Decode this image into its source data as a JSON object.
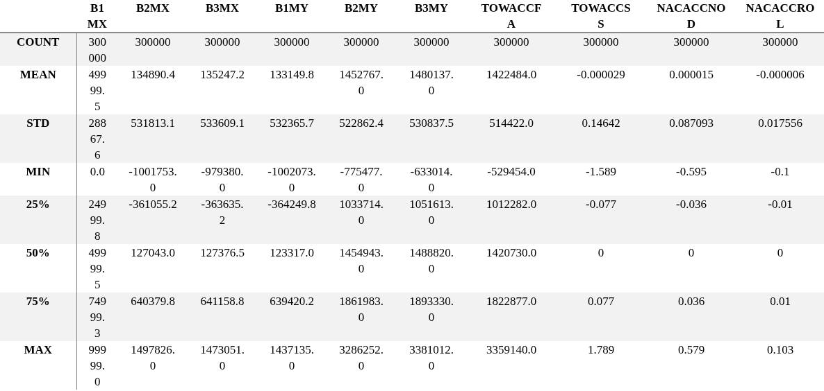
{
  "table": {
    "columns": [
      "B1MX",
      "B2MX",
      "B3MX",
      "B1MY",
      "B2MY",
      "B3MY",
      "TOWACCFA",
      "TOWACCSS",
      "NACACCNOD",
      "NACACCROL"
    ],
    "rows": [
      {
        "label": "COUNT",
        "values": [
          "300000",
          "300000",
          "300000",
          "300000",
          "300000",
          "300000",
          "300000",
          "300000",
          "300000",
          "300000"
        ]
      },
      {
        "label": "MEAN",
        "values": [
          "49999.5",
          "134890.4",
          "135247.2",
          "133149.8",
          "1452767.0",
          "1480137.0",
          "1422484.0",
          "-0.000029",
          "0.000015",
          "-0.000006"
        ]
      },
      {
        "label": "STD",
        "values": [
          "28867.6",
          "531813.1",
          "533609.1",
          "532365.7",
          "522862.4",
          "530837.5",
          "514422.0",
          "0.14642",
          "0.087093",
          "0.017556"
        ]
      },
      {
        "label": "MIN",
        "values": [
          "0.0",
          "-1001753.0",
          "-979380.0",
          "-1002073.0",
          "-775477.0",
          "-633014.0",
          "-529454.0",
          "-1.589",
          "-0.595",
          "-0.1"
        ]
      },
      {
        "label": "25%",
        "values": [
          "24999.8",
          "-361055.2",
          "-363635.2",
          "-364249.8",
          "1033714.0",
          "1051613.0",
          "1012282.0",
          "-0.077",
          "-0.036",
          "-0.01"
        ]
      },
      {
        "label": "50%",
        "values": [
          "49999.5",
          "127043.0",
          "127376.5",
          "123317.0",
          "1454943.0",
          "1488820.0",
          "1420730.0",
          "0",
          "0",
          "0"
        ]
      },
      {
        "label": "75%",
        "values": [
          "74999.3",
          "640379.8",
          "641158.8",
          "639420.2",
          "1861983.0",
          "1893330.0",
          "1822877.0",
          "0.077",
          "0.036",
          "0.01"
        ]
      },
      {
        "label": "MAX",
        "values": [
          "99999.0",
          "1497826.0",
          "1473051.0",
          "1437135.0",
          "3286252.0",
          "3381012.0",
          "3359140.0",
          "1.789",
          "0.579",
          "0.103"
        ]
      }
    ]
  }
}
